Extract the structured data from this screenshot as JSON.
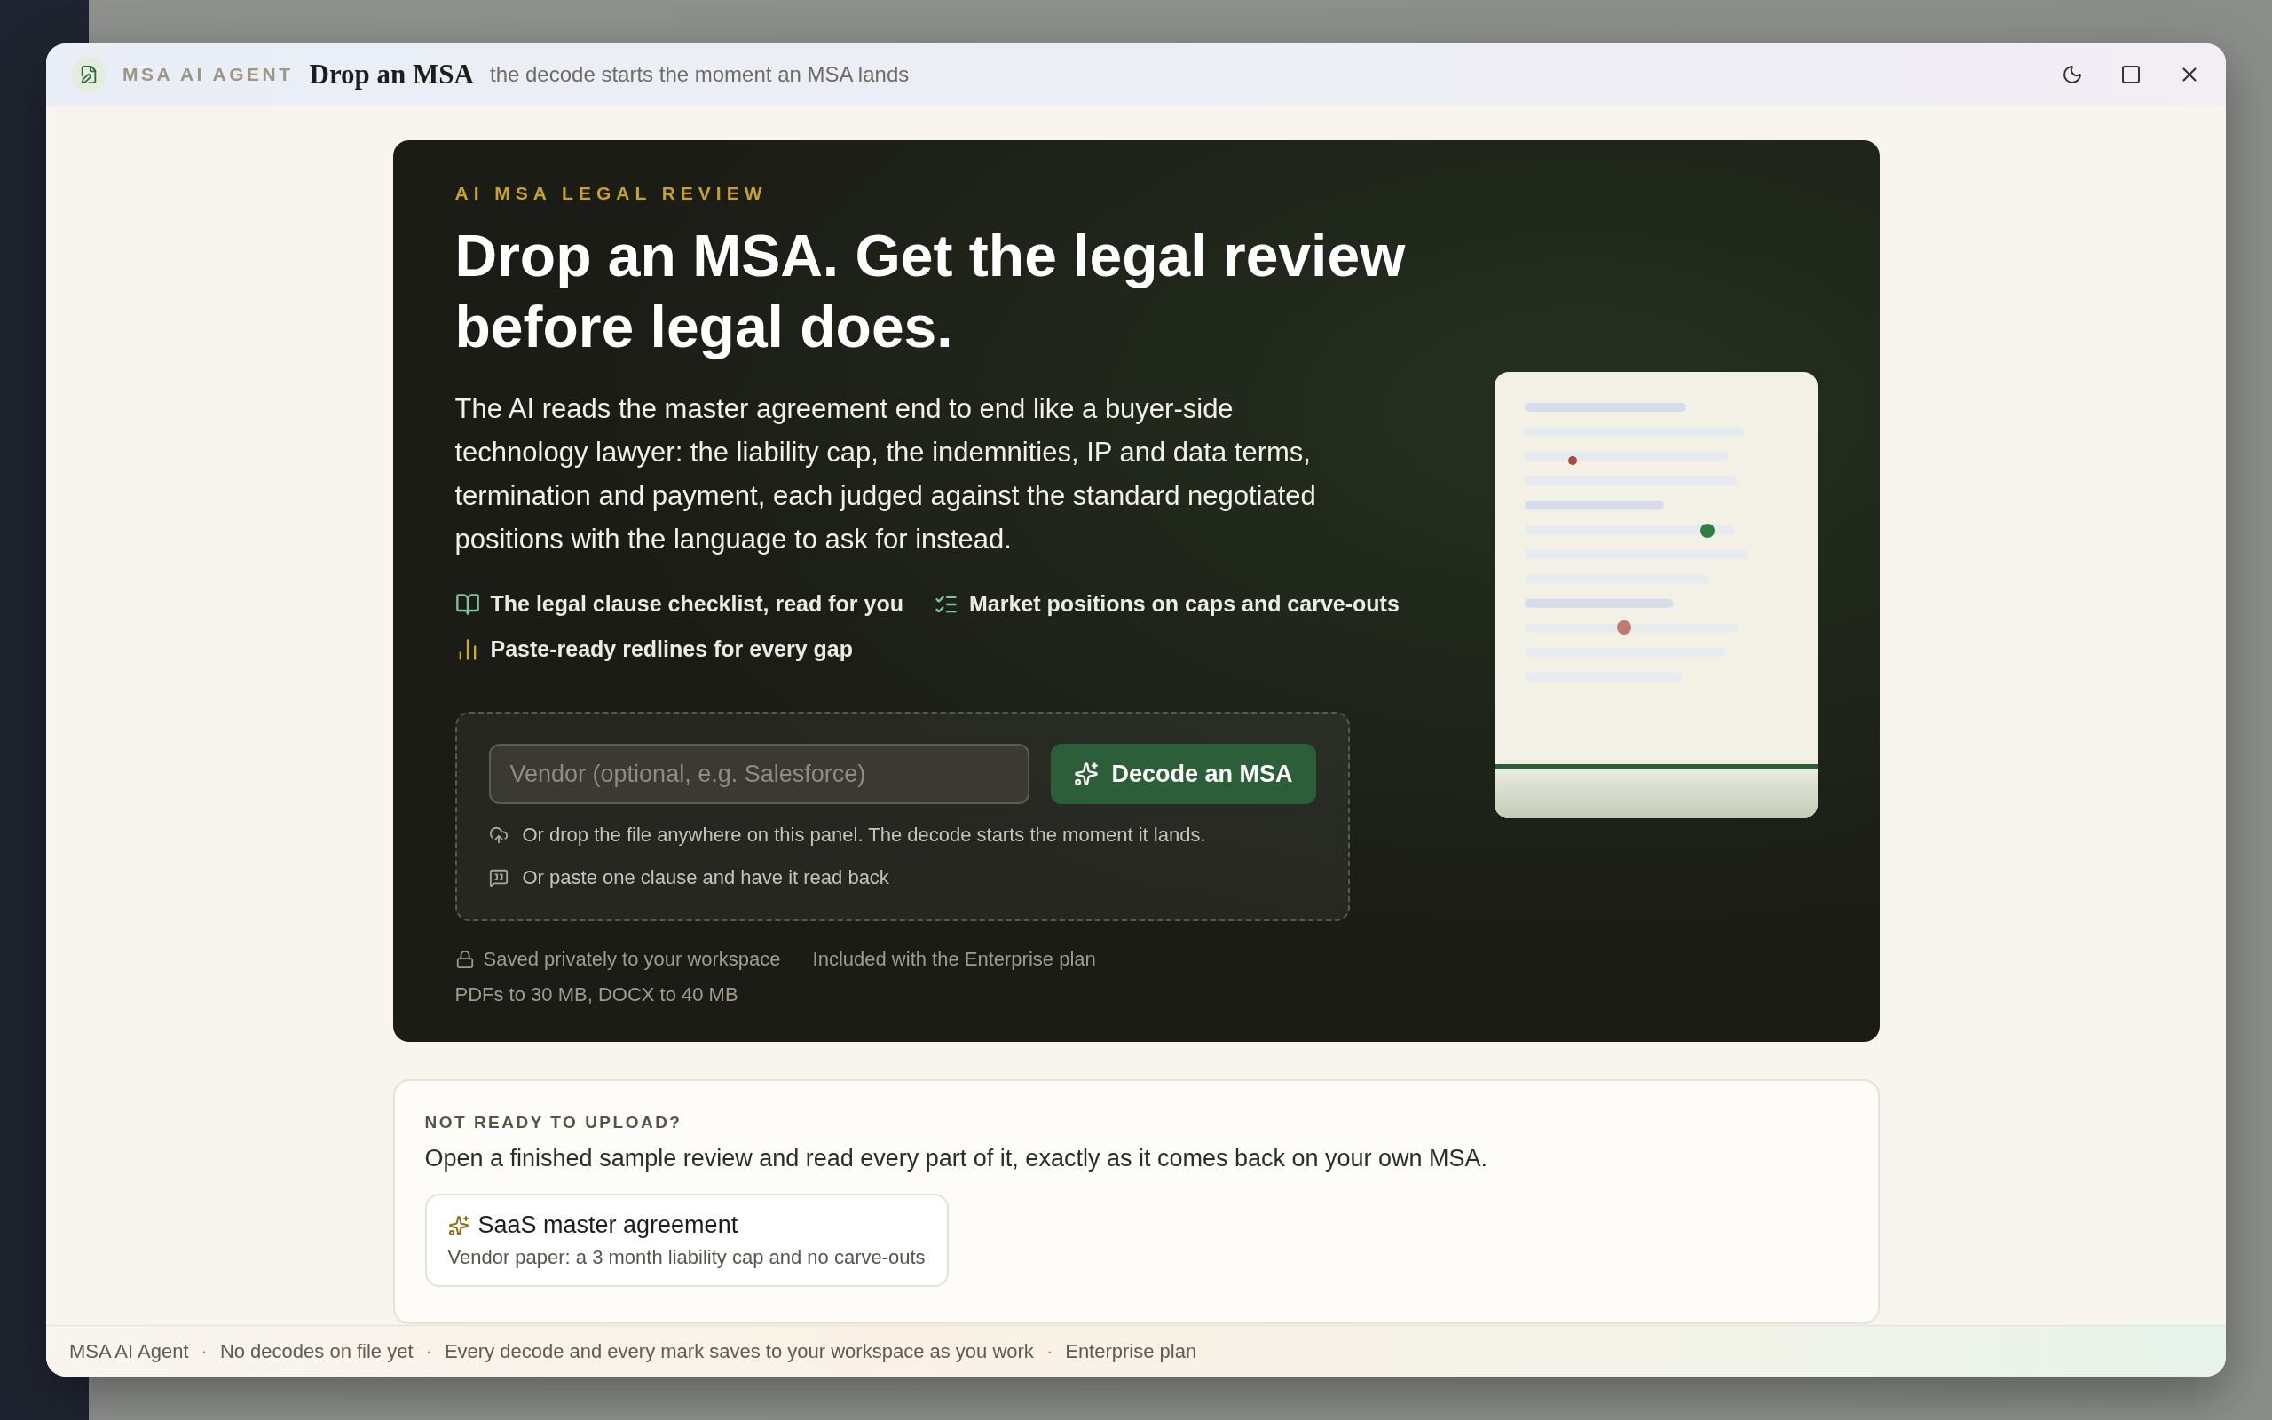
{
  "window": {
    "eyebrow": "MSA AI AGENT",
    "title": "Drop an MSA",
    "subtitle": "the decode starts the moment an MSA lands"
  },
  "hero": {
    "eyebrow": "AI MSA LEGAL REVIEW",
    "headline": "Drop an MSA. Get the legal review before legal does.",
    "description": "The AI reads the master agreement end to end like a buyer-side technology lawyer: the liability cap, the indemnities, IP and data terms, termination and payment, each judged against the standard negotiated positions with the language to ask for instead.",
    "features": [
      {
        "label": "The legal clause checklist, read for you"
      },
      {
        "label": "Market positions on caps and carve-outs"
      },
      {
        "label": "Paste-ready redlines for every gap"
      }
    ],
    "vendor_field": {
      "placeholder": "Vendor (optional, e.g. Salesforce)"
    },
    "decode_button": "Decode an MSA",
    "hints": [
      {
        "text": "Or drop the file anywhere on this panel. The decode starts the moment it lands."
      },
      {
        "text": "Or paste one clause and have it read back"
      }
    ],
    "meta_lines": [
      [
        {
          "text": "Saved privately to your workspace"
        },
        {
          "text": "Included with the Enterprise plan"
        }
      ],
      [
        {
          "text": "PDFs to 30 MB, DOCX to 40 MB"
        }
      ]
    ]
  },
  "sample": {
    "eyebrow": "NOT READY TO UPLOAD?",
    "description": "Open a finished sample review and read every part of it, exactly as it comes back on your own MSA.",
    "cards": [
      {
        "title": "SaaS master agreement",
        "subtitle": "Vendor paper: a 3 month liability cap and no carve-outs"
      }
    ]
  },
  "status_bar": [
    "MSA AI Agent",
    "·",
    "No decodes on file yet",
    "·",
    "Every decode and every mark saves to your workspace as you work",
    "·",
    "Enterprise plan"
  ]
}
